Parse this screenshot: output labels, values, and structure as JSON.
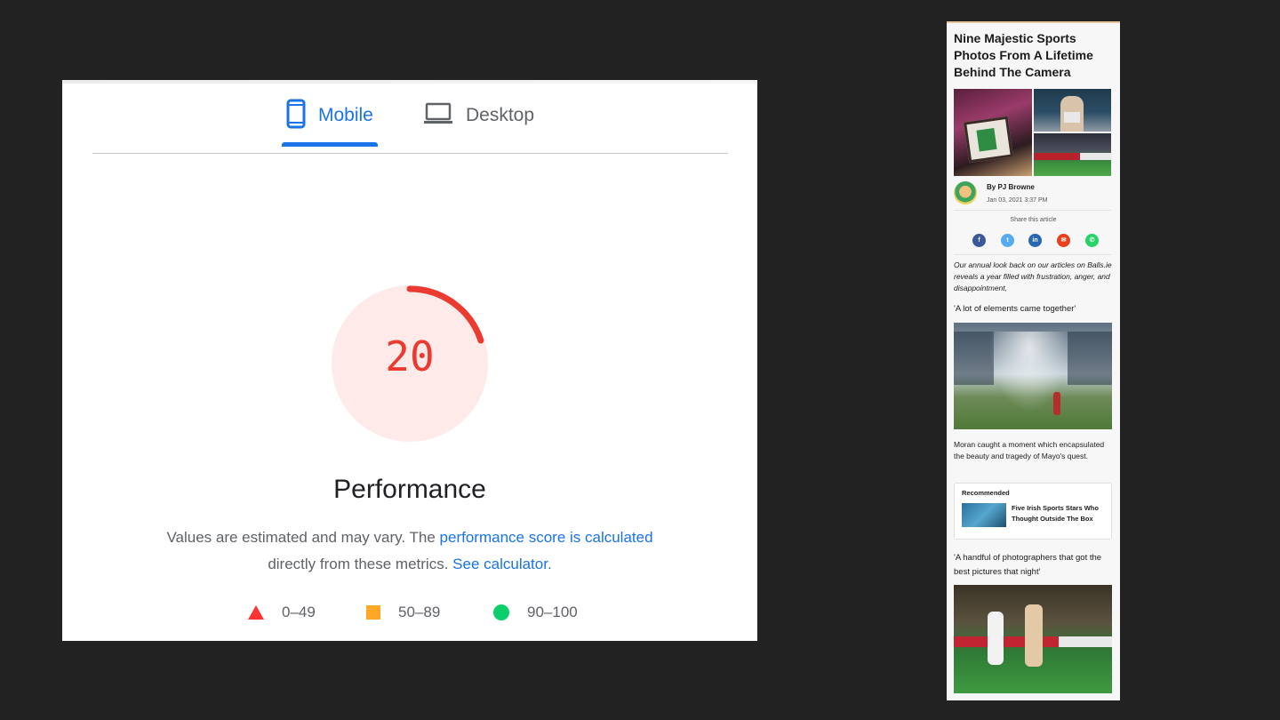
{
  "pagespeed": {
    "tabs": {
      "mobile": "Mobile",
      "desktop": "Desktop"
    },
    "active_tab": "Mobile",
    "score": "20",
    "score_value": 20,
    "colors": {
      "fail": "#f33",
      "average": "#ffa726",
      "pass": "#0cce6b",
      "accent": "#1a73e8"
    },
    "title": "Performance",
    "desc": {
      "prefix": "Values are estimated and may vary. The ",
      "link1": "performance score is calculated",
      "middle": " directly from these metrics. ",
      "link2": "See calculator."
    },
    "legend": [
      {
        "label": "0–49",
        "icon": "triangle-icon"
      },
      {
        "label": "50–89",
        "icon": "square-icon"
      },
      {
        "label": "90–100",
        "icon": "circle-icon"
      }
    ]
  },
  "article": {
    "title": "Nine Majestic Sports Photos From A Lifetime Behind The Camera",
    "author": "By PJ Browne",
    "date": "Jan 03, 2021 3:37 PM",
    "share_label": "Share this article",
    "share_icons": [
      "facebook-icon",
      "twitter-icon",
      "linkedin-icon",
      "email-icon",
      "whatsapp-icon"
    ],
    "intro": "Our annual look back on our articles on Balls.ie reveals a year filled with frustration, anger, and disappointment,",
    "subhead_1": "'A lot of elements came together'",
    "caption_1": "Moran caught a moment which encapsulated the beauty and tragedy of Mayo's quest.",
    "recommended": {
      "label": "Recommended",
      "title": "Five Irish Sports Stars Who Thought Outside The Box"
    },
    "subhead_2": "'A handful of photographers that got the best pictures that night'"
  }
}
